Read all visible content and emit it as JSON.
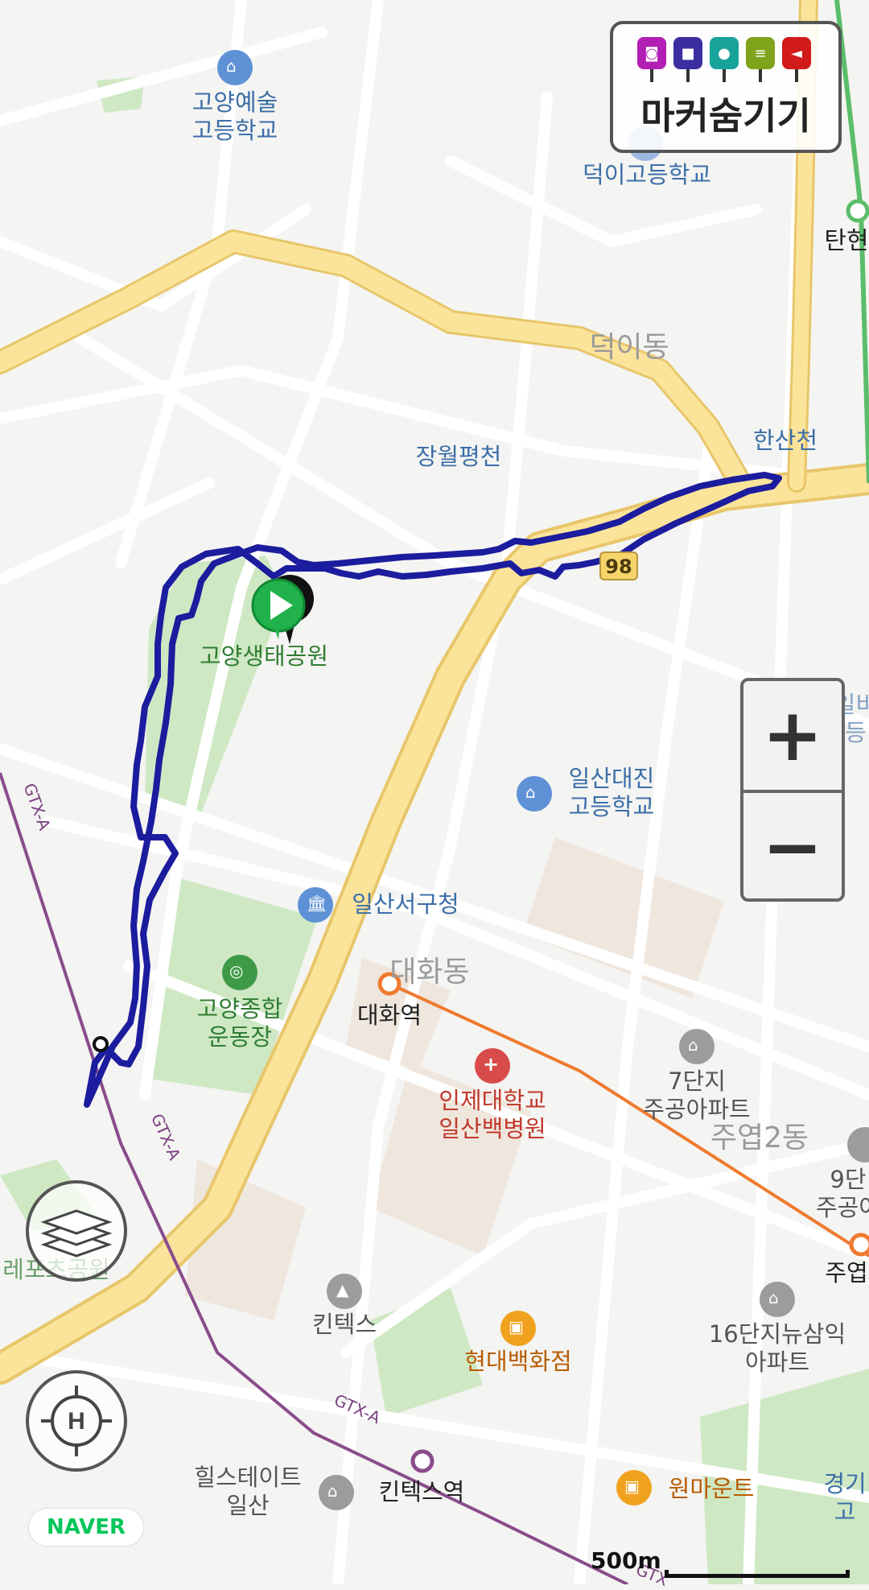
{
  "map": {
    "places": {
      "goyang_arts_hs": "고양예술\n고등학교",
      "deogi_hs": "덕이고등학교",
      "tanhyeon": "탄현",
      "deogi_dong": "덕이동",
      "hansancheon": "한산천",
      "jangwol_stream": "장월평천",
      "road_98": "98",
      "eco_park": "고양생태공원",
      "sinilbi_hs": "신일비\n고등",
      "daejin_hs": "일산대진\n고등학교",
      "ilsanseo_office": "일산서구청",
      "daehwa_dong": "대화동",
      "daehwa_station": "대화역",
      "sports_complex": "고양종합\n운동장",
      "apt_7": "7단지\n주공아파트",
      "juyeop2": "주엽2동",
      "inje_hospital": "인제대학교\n일산백병원",
      "apt_9": "9단\n주공아",
      "juyeop": "주엽",
      "leisure_park": "레포츠공원",
      "kintex": "킨텍스",
      "hyundai_dept": "현대백화점",
      "apt_16": "16단지뉴삼익\n아파트",
      "hillstate": "힐스테이트\n일산",
      "kintex_station": "킨텍스역",
      "onemount": "원마운트",
      "gyeonggi": "경기\n고",
      "gtx_a_1": "GTX-A",
      "gtx_a_2": "GTX-A",
      "gtx_a_3": "GTX-A",
      "gtx_a_4": "GTX"
    },
    "scale_label": "500m",
    "brand": "NAVER"
  },
  "marker_panel": {
    "label": "마커숨기기",
    "icons": [
      "camera-icon",
      "video-icon",
      "microphone-icon",
      "note-icon",
      "flag-icon"
    ],
    "icon_colors": [
      "#b21fb5",
      "#3b2ea0",
      "#17a39a",
      "#7fa31a",
      "#d11a1a"
    ]
  },
  "controls": {
    "zoom_in": "+",
    "zoom_out": "−"
  },
  "colors": {
    "route": "#1c1c9e",
    "major_road": "#fbe49a",
    "gtx_line": "#7a3f80",
    "subway_line": "#ee7a2f",
    "park": "#cfe8c4",
    "start_marker": "#21b24b"
  }
}
